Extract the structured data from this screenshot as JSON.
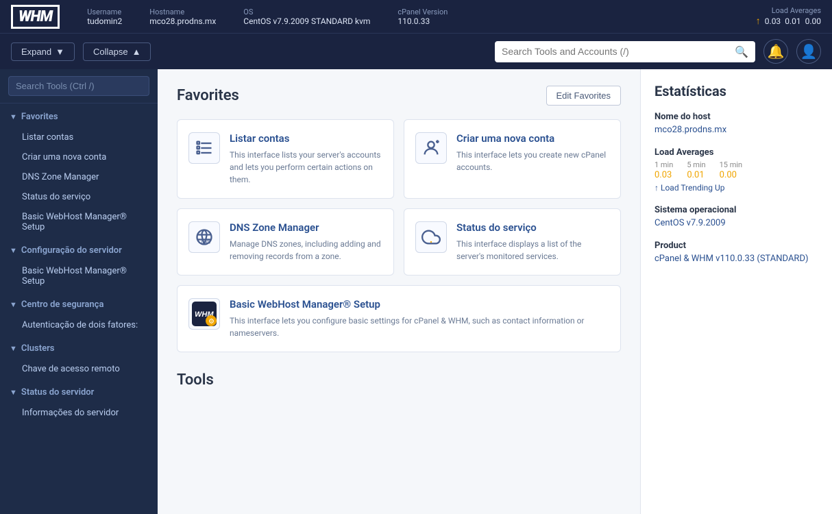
{
  "topbar": {
    "logo": "WHM",
    "username_label": "Username",
    "username": "tudomin2",
    "hostname_label": "Hostname",
    "hostname": "mco28.prodns.mx",
    "os_label": "OS",
    "os": "CentOS v7.9.2009 STANDARD kvm",
    "cpanel_label": "cPanel Version",
    "cpanel": "110.0.33",
    "loadavg_label": "Load Averages",
    "load1": "0.03",
    "load5": "0.01",
    "load15": "0.00"
  },
  "toolbar": {
    "expand_label": "Expand",
    "collapse_label": "Collapse",
    "search_placeholder": "Search Tools and Accounts (/)",
    "search_label": "Search Tools and Accounts (/)"
  },
  "sidebar": {
    "search_placeholder": "Search Tools (Ctrl /)",
    "sections": [
      {
        "label": "Favorites",
        "items": [
          "Listar contas",
          "Criar uma nova conta",
          "DNS Zone Manager",
          "Status do serviço",
          "Basic WebHost Manager® Setup"
        ]
      },
      {
        "label": "Configuração do servidor",
        "items": [
          "Basic WebHost Manager® Setup"
        ]
      },
      {
        "label": "Centro de segurança",
        "items": [
          "Autenticação de dois fatores:"
        ]
      },
      {
        "label": "Clusters",
        "items": [
          "Chave de acesso remoto"
        ]
      },
      {
        "label": "Status do servidor",
        "items": [
          "Informações do servidor"
        ]
      }
    ]
  },
  "favorites": {
    "section_title": "Favorites",
    "edit_button": "Edit Favorites",
    "cards": [
      {
        "id": "listar-contas",
        "title": "Listar contas",
        "desc": "This interface lists your server's accounts and lets you perform certain actions on them.",
        "icon": "list"
      },
      {
        "id": "criar-conta",
        "title": "Criar uma nova conta",
        "desc": "This interface lets you create new cPanel accounts.",
        "icon": "add-user"
      },
      {
        "id": "dns-zone",
        "title": "DNS Zone Manager",
        "desc": "Manage DNS zones, including adding and removing records from a zone.",
        "icon": "dns"
      },
      {
        "id": "status-servico",
        "title": "Status do serviço",
        "desc": "This interface displays a list of the server's monitored services.",
        "icon": "cloud"
      },
      {
        "id": "basic-setup",
        "title": "Basic WebHost Manager® Setup",
        "desc": "This interface lets you configure basic settings for cPanel & WHM, such as contact information or nameservers.",
        "icon": "whm-setup"
      }
    ]
  },
  "stats": {
    "title": "Estatísticas",
    "hostname_label": "Nome do host",
    "hostname": "mco28.prodns.mx",
    "loadavg_label": "Load Averages",
    "load_1min_label": "1 min",
    "load_5min_label": "5 min",
    "load_15min_label": "15 min",
    "load_1min": "0.03",
    "load_5min": "0.01",
    "load_15min": "0.00",
    "load_trending": "Load Trending Up",
    "os_label": "Sistema operacional",
    "os": "CentOS v7.9.2009",
    "product_label": "Product",
    "product": "cPanel & WHM v110.0.33 (STANDARD)"
  },
  "tools": {
    "section_title": "Tools"
  }
}
